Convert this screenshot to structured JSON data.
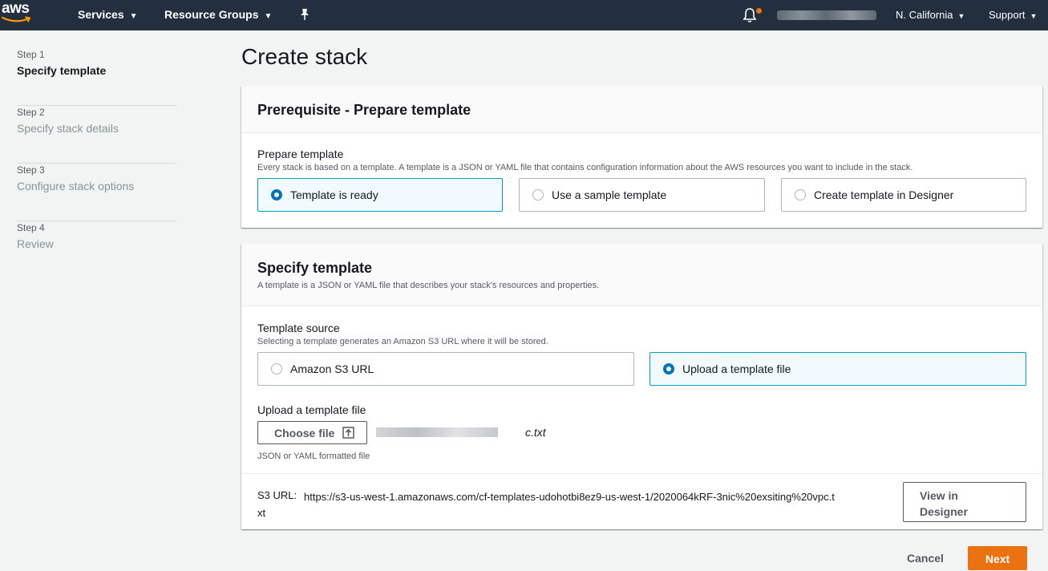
{
  "topnav": {
    "logo_text": "aws",
    "services_label": "Services",
    "resource_groups_label": "Resource Groups",
    "region_label": "N. California",
    "support_label": "Support",
    "pin_icon": "pushpin-icon",
    "bell_icon": "bell-icon",
    "notification_dot_color": "#ec7211"
  },
  "steps": [
    {
      "num": "Step 1",
      "label": "Specify template",
      "active": true
    },
    {
      "num": "Step 2",
      "label": "Specify stack details",
      "active": false
    },
    {
      "num": "Step 3",
      "label": "Configure stack options",
      "active": false
    },
    {
      "num": "Step 4",
      "label": "Review",
      "active": false
    }
  ],
  "page_title": "Create stack",
  "prerequisite": {
    "title": "Prerequisite - Prepare template",
    "field_label": "Prepare template",
    "field_desc": "Every stack is based on a template. A template is a JSON or YAML file that contains configuration information about the AWS resources you want to include in the stack.",
    "options": [
      {
        "label": "Template is ready",
        "selected": true
      },
      {
        "label": "Use a sample template",
        "selected": false
      },
      {
        "label": "Create template in Designer",
        "selected": false
      }
    ]
  },
  "specify": {
    "title": "Specify template",
    "desc": "A template is a JSON or YAML file that describes your stack's resources and properties.",
    "source_label": "Template source",
    "source_desc": "Selecting a template generates an Amazon S3 URL where it will be stored.",
    "source_options": [
      {
        "label": "Amazon S3 URL",
        "selected": false
      },
      {
        "label": "Upload a template file",
        "selected": true
      }
    ],
    "upload_label": "Upload a template file",
    "choose_file_label": "Choose file",
    "file_name_suffix": "c.txt",
    "file_hint": "JSON or YAML formatted file",
    "s3_label": "S3 URL:",
    "s3_url_line1": "https://s3-us-west-1.amazonaws.com/cf-templates-udohotbi8ez9-us-west-1/2020064kRF-3nic%20exsiting%20vpc.t",
    "s3_url_line2": "xt",
    "view_designer_label": "View in Designer"
  },
  "footer": {
    "cancel_label": "Cancel",
    "next_label": "Next",
    "next_color": "#ec7211"
  }
}
